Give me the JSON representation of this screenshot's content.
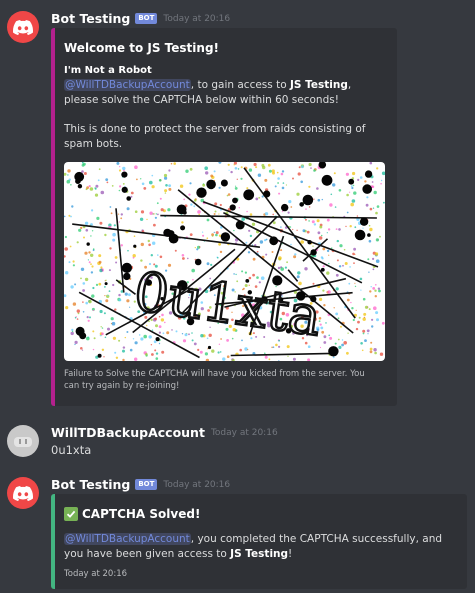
{
  "messages": [
    {
      "username": "Bot Testing",
      "bot_tag": "BOT",
      "timestamp": "Today at 20:16",
      "embed": {
        "title": "Welcome to JS Testing!",
        "field_name": "I'm Not a Robot",
        "mention": "@WillTDBackupAccount",
        "text_1": ", to gain access to ",
        "server": "JS Testing",
        "text_2": ", please solve the CAPTCHA below within 60 seconds!",
        "text_3": "This is done to protect the server from raids consisting of spam bots.",
        "captcha_text": "0u1xta",
        "footer": "Failure to Solve the CAPTCHA will have you kicked from the server. You can try again by re-joining!",
        "accent_color": "#b4218e"
      }
    },
    {
      "username": "WillTDBackupAccount",
      "timestamp": "Today at 20:16",
      "content": "0u1xta"
    },
    {
      "username": "Bot Testing",
      "bot_tag": "BOT",
      "timestamp": "Today at 20:16",
      "embed": {
        "title": "CAPTCHA Solved!",
        "title_icon": "white-check-mark",
        "mention": "@WillTDBackupAccount",
        "text_1": ", you completed the CAPTCHA successfully, and you have been given access to ",
        "server": "JS Testing",
        "text_2": "!",
        "footer": "Today at 20:16",
        "accent_color": "#43b581"
      }
    }
  ]
}
